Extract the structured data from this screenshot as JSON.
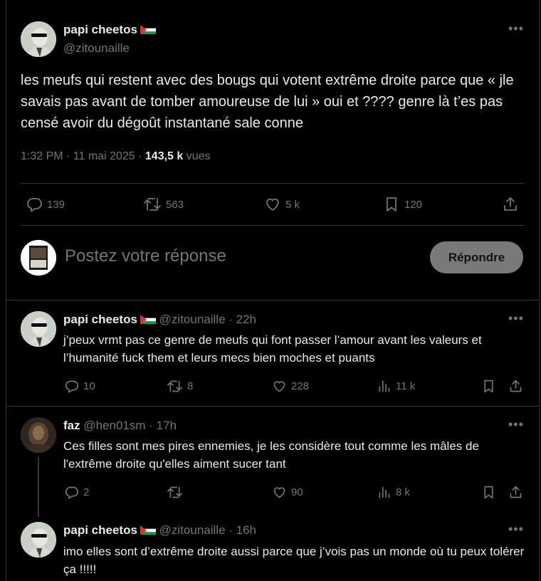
{
  "main_tweet": {
    "author_name": "papi cheetos",
    "handle": "@zitounaille",
    "text": "les meufs qui restent avec des bougs qui votent extrême droite parce que « jle savais pas avant de tomber amoureuse de lui » oui et ???? genre là t’es pas censé avoir du dégoût instantané sale conne",
    "time": "1:32 PM · 11 mai 2025 · ",
    "views_count": "143,5 k",
    "views_label": " vues",
    "stats": {
      "replies": "139",
      "retweets": "563",
      "likes": "5 k",
      "bookmarks": "120"
    }
  },
  "composer": {
    "placeholder": "Postez votre réponse",
    "button_label": "Répondre"
  },
  "replies": [
    {
      "author_name": "papi cheetos",
      "handle": "@zitounaille",
      "time": " · 22h",
      "text": "j’peux vrmt pas ce genre de meufs qui font passer l’amour avant les valeurs et l’humanité fuck them et leurs mecs bien moches et puants",
      "stats": {
        "replies": "10",
        "retweets": "8",
        "likes": "228",
        "views": "11 k"
      }
    },
    {
      "author_name": "faz",
      "handle": "@hen01sm",
      "time": " · 17h",
      "text": "Ces filles sont mes pires ennemies, je les considère tout comme les mâles de l'extrême droite qu'elles aiment sucer tant",
      "stats": {
        "replies": "2",
        "retweets": "",
        "likes": "90",
        "views": "8 k"
      }
    },
    {
      "author_name": "papi cheetos",
      "handle": "@zitounaille",
      "time": " · 16h",
      "text": "imo elles sont d’extrême droite aussi parce que j’vois pas un monde où tu peux tolérer ça !!!!!"
    }
  ],
  "icons": {
    "reply": "reply-icon",
    "retweet": "retweet-icon",
    "like": "heart-icon",
    "bookmark": "bookmark-icon",
    "share": "share-icon",
    "views": "views-chart-icon",
    "more": "more-icon"
  },
  "colors": {
    "background": "#000000",
    "text": "#e7e9ea",
    "muted": "#71767b",
    "divider": "#2f3336",
    "button": "#787a7a"
  }
}
